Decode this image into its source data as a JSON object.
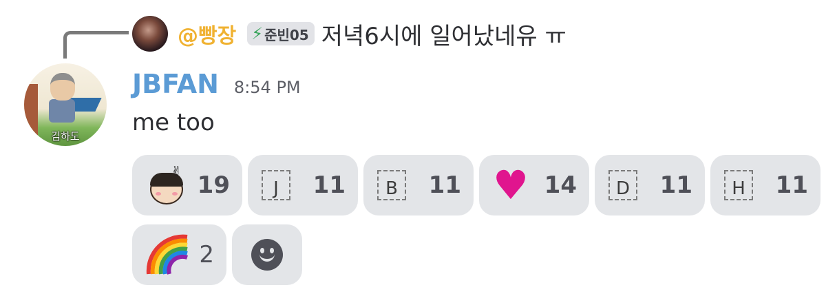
{
  "reply": {
    "mention": "@빵장",
    "tag_text": "준빈05",
    "tag_icon": "lightning-bolt-icon",
    "text": "저녁6시에 일어났네유 ㅠ"
  },
  "message": {
    "username": "JBFAN",
    "username_color": "#5b9bd5",
    "timestamp": "8:54 PM",
    "content": "me too",
    "avatar_caption": "김하도"
  },
  "reactions": [
    {
      "emoji": "sticker-kid-peace-sign",
      "count": "19"
    },
    {
      "emoji": "letter-J",
      "letter": "J",
      "count": "11"
    },
    {
      "emoji": "letter-B",
      "letter": "B",
      "count": "11"
    },
    {
      "emoji": "pink-heart",
      "glyph": "♥",
      "count": "14"
    },
    {
      "emoji": "letter-D",
      "letter": "D",
      "count": "11"
    },
    {
      "emoji": "letter-H",
      "letter": "H",
      "count": "11"
    },
    {
      "emoji": "rainbow",
      "count": "2"
    }
  ],
  "add_reaction": {
    "icon": "smiley-face-icon"
  },
  "colors": {
    "mention": "#f0b232",
    "reaction_bg": "#e3e5e8",
    "count_text": "#4f5058",
    "heart": "#e0158e"
  }
}
